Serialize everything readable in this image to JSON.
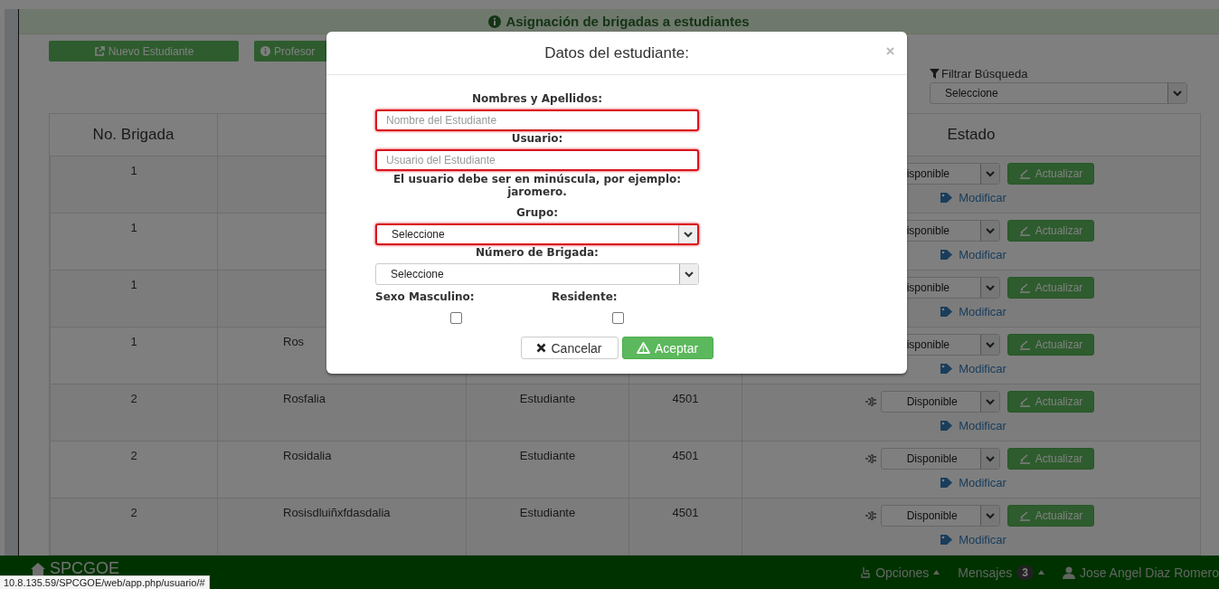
{
  "panel": {
    "title": "Asignación de brigadas a estudiantes",
    "toolbar_buttons": [
      {
        "label": "Nuevo Estudiante",
        "kind": "external"
      },
      {
        "label": "Profesor",
        "kind": "info"
      }
    ],
    "filter": {
      "label": "Filtrar Búsqueda",
      "value": "Seleccione"
    },
    "table": {
      "columns": [
        "No. Brigada",
        "Estado"
      ],
      "rows": [
        {
          "no_brigada": "1",
          "estado": "isponible",
          "action": "Actualizar",
          "link": "Modificar"
        },
        {
          "no_brigada": "1",
          "estado": "isponible",
          "action": "Actualizar",
          "link": "Modificar"
        },
        {
          "no_brigada": "1",
          "estado": "isponible",
          "action": "Actualizar",
          "link": "Modificar"
        },
        {
          "no_brigada": "1",
          "column_2": "Ros",
          "estado": "isponible",
          "action": "Actualizar",
          "link": "Modificar"
        },
        {
          "no_brigada": "2",
          "column_2": "Rosfalia",
          "column_3": "Estudiante",
          "column_4": "4501",
          "estado": "Disponible",
          "action": "Actualizar",
          "link": "Modificar"
        },
        {
          "no_brigada": "2",
          "column_2": "Rosidalia",
          "column_3": "Estudiante",
          "column_4": "4501",
          "estado": "Disponible",
          "action": "Actualizar",
          "link": "Modificar"
        },
        {
          "no_brigada": "2",
          "column_2": "Rosisdluiñxfdasdalia",
          "column_3": "Estudiante",
          "column_4": "4501",
          "estado": "Disponible",
          "action": "Actualizar",
          "link": "Modificar"
        }
      ]
    }
  },
  "dialog": {
    "title": "Datos del estudiante:",
    "fields": [
      {
        "kind": "text",
        "label": "Nombres y Apellidos:",
        "placeholder": "Nombre del Estudiante",
        "invalid": true
      },
      {
        "kind": "text",
        "label": "Usuario:",
        "placeholder": "Usuario del Estudiante",
        "invalid": true,
        "hint": "El usuario debe ser en minúscula, por ejemplo: jaromero."
      },
      {
        "kind": "select",
        "label": "Grupo:",
        "value": "Seleccione",
        "invalid": true
      },
      {
        "kind": "select",
        "label": "Número de Brigada:",
        "value": "Seleccione",
        "invalid": false
      }
    ],
    "checkboxes": [
      {
        "label": "Sexo Masculino:",
        "checked": false
      },
      {
        "label": "Residente:",
        "checked": false
      }
    ],
    "buttons": [
      {
        "label": "Cancelar",
        "kind": "cancel"
      },
      {
        "label": "Aceptar",
        "kind": "accept"
      }
    ]
  },
  "footer": {
    "brand": "SPCGOE",
    "menus": [
      {
        "kind": "options",
        "label": "Opciones"
      },
      {
        "kind": "messages",
        "label": "Mensajes",
        "badge": "3"
      },
      {
        "kind": "user",
        "label": "Jose Angel Diaz Romero"
      }
    ]
  },
  "status_url": "10.8.135.59/SPCGOE/web/app.php/usuario/#"
}
